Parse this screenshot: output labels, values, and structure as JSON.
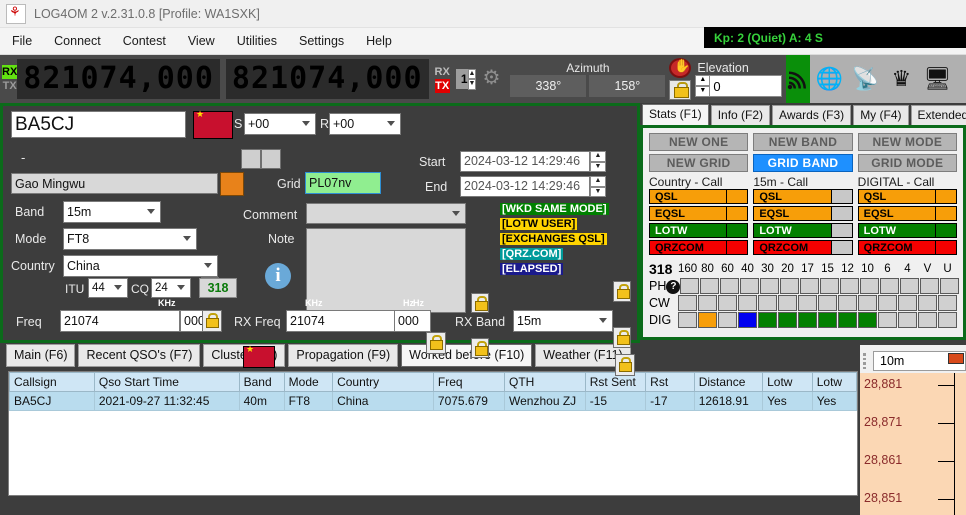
{
  "window": {
    "title": "LOG4OM 2 v.2.31.0.8 [Profile: WA1SXK]",
    "logo_icon": "log4om-logo-icon"
  },
  "menu": {
    "items": [
      "File",
      "Connect",
      "Contest",
      "View",
      "Utilities",
      "Settings",
      "Help"
    ]
  },
  "space_weather": {
    "text": "Kp: 2 (Quiet)  A: 4  S"
  },
  "rig_toolbar": {
    "rx_label": "RX",
    "tx_label": "TX",
    "vfo_a": {
      "leading": "8",
      "active": "21074",
      "trailing": "000",
      "separator": ","
    },
    "vfo_b": {
      "leading": "8",
      "active": "21074",
      "trailing": "000",
      "separator": ","
    },
    "rx_label_right": "RX",
    "tx_label_right": "TX",
    "radio_number": "1",
    "gear_icon": "gear-icon",
    "azimuth_label": "Azimuth",
    "azimuth_value": "338°",
    "azimuth_long_value": "158°",
    "stop_icon": "stop-hand-icon",
    "rotor_lock_icon": "lock-icon",
    "elevation_label": "Elevation",
    "elevation_value": "0",
    "signal_icon": "signal-waves-icon",
    "icons": [
      "globe-icon",
      "satellite-dish-icon",
      "crown-icon",
      "server-icon",
      "calculator-icon"
    ]
  },
  "qso_entry": {
    "callsign": "BA5CJ",
    "country_flag_icon": "china-flag-icon",
    "rst_sent_label": "S",
    "rst_sent": "+00",
    "rst_rcvd_label": "R",
    "rst_rcvd": "+00",
    "dash": "-",
    "name": "Gao Mingwu",
    "qrz_icon": "qrz-lookup-icon",
    "grid_label": "Grid",
    "grid": "PL07nv",
    "band_label": "Band",
    "band": "15m",
    "mode_label": "Mode",
    "mode": "FT8",
    "country_label": "Country",
    "country": "China",
    "itu_label": "ITU",
    "itu": "44",
    "cq_label": "CQ",
    "cq": "24",
    "dxcc": "318",
    "info_icon": "info-icon",
    "comment_label": "Comment",
    "comment": "",
    "note_label": "Note",
    "note": "",
    "start_label": "Start",
    "start": "2024-03-12 14:29:46",
    "end_label": "End",
    "end": "2024-03-12 14:29:46",
    "lock_icon": "lock-icon",
    "tags": [
      {
        "text": "[WKD SAME MODE]",
        "bg": "#008000",
        "fg": "#ffffff"
      },
      {
        "text": "[LOTW USER]",
        "bg": "#ffd400",
        "fg": "#000000"
      },
      {
        "text": "[EXCHANGES QSL]",
        "bg": "#ffd400",
        "fg": "#000000"
      },
      {
        "text": "[QRZ.COM]",
        "bg": "#009a9a",
        "fg": "#ffffff"
      },
      {
        "text": "[ELAPSED]",
        "bg": "#1a1a8c",
        "fg": "#ffffff"
      }
    ]
  },
  "freq_row": {
    "freq_label": "Freq",
    "khz_label": "KHz",
    "hz_label": "Hz",
    "freq_khz": "21074",
    "freq_hz": "000",
    "rx_freq_label": "RX Freq",
    "rx_khz_label": "KHz",
    "rx_hz_label": "Hz",
    "rx_freq_khz": "21074",
    "rx_freq_hz": "000",
    "rx_band_label": "RX Band",
    "rx_band": "15m",
    "lock_icon": "lock-icon"
  },
  "stats_panel": {
    "tabs": [
      {
        "label": "Stats (F1)",
        "active": true
      },
      {
        "label": "Info (F2)",
        "active": false
      },
      {
        "label": "Awards (F3)",
        "active": false
      },
      {
        "label": "My (F4)",
        "active": false
      },
      {
        "label": "Extended",
        "active": false
      }
    ],
    "status_buttons": [
      {
        "label": "NEW ONE",
        "state": "off"
      },
      {
        "label": "NEW BAND",
        "state": "off"
      },
      {
        "label": "NEW MODE",
        "state": "off"
      },
      {
        "label": "NEW GRID",
        "state": "off"
      },
      {
        "label": "GRID BAND",
        "state": "on"
      },
      {
        "label": "GRID MODE",
        "state": "off"
      }
    ],
    "columns": [
      {
        "header": "Country - Call",
        "rows": [
          {
            "label": "QSL",
            "color": "or",
            "square": "or"
          },
          {
            "label": "EQSL",
            "color": "or",
            "square": "or"
          },
          {
            "label": "LOTW",
            "color": "gr",
            "square": "gr"
          },
          {
            "label": "QRZCOM",
            "color": "rd",
            "square": "rd"
          }
        ]
      },
      {
        "header": "15m - Call",
        "rows": [
          {
            "label": "QSL",
            "color": "or",
            "square": "gy"
          },
          {
            "label": "EQSL",
            "color": "or",
            "square": "gy"
          },
          {
            "label": "LOTW",
            "color": "gr",
            "square": "gy"
          },
          {
            "label": "QRZCOM",
            "color": "rd",
            "square": "gy"
          }
        ]
      },
      {
        "header": "DIGITAL - Call",
        "rows": [
          {
            "label": "QSL",
            "color": "or",
            "square": "or"
          },
          {
            "label": "EQSL",
            "color": "or",
            "square": "or"
          },
          {
            "label": "LOTW",
            "color": "gr",
            "square": "gr"
          },
          {
            "label": "QRZCOM",
            "color": "rd",
            "square": "rd"
          }
        ]
      }
    ],
    "dxcc_count": "318",
    "band_headers": [
      "160",
      "80",
      "60",
      "40",
      "30",
      "20",
      "17",
      "15",
      "12",
      "10",
      "6",
      "4",
      "V",
      "U"
    ],
    "help_icon": "help-icon",
    "mode_rows": [
      {
        "label": "PH",
        "cells": [
          "gy",
          "gy",
          "gy",
          "gy",
          "gy",
          "gy",
          "gy",
          "gy",
          "gy",
          "gy",
          "gy",
          "gy",
          "gy",
          "gy"
        ]
      },
      {
        "label": "CW",
        "cells": [
          "gy",
          "gy",
          "gy",
          "gy",
          "gy",
          "gy",
          "gy",
          "gy",
          "gy",
          "gy",
          "gy",
          "gy",
          "gy",
          "gy"
        ]
      },
      {
        "label": "DIG",
        "cells": [
          "gy",
          "o",
          "gy",
          "b",
          "g",
          "g",
          "g",
          "g",
          "g",
          "g",
          "gy",
          "gy",
          "gy",
          "gy"
        ]
      }
    ]
  },
  "bottom_tabs": [
    {
      "label": "Main (F6)",
      "active": false
    },
    {
      "label": "Recent QSO's (F7)",
      "active": false
    },
    {
      "label": "Cluster (F8)",
      "active": false
    },
    {
      "label": "Propagation (F9)",
      "active": false
    },
    {
      "label": "Worked before (F10)",
      "active": true
    },
    {
      "label": "Weather (F11)",
      "active": false
    }
  ],
  "worked_before_table": {
    "columns": [
      "Callsign",
      "Qso Start Time",
      "Band",
      "Mode",
      "Country",
      "Freq",
      "QTH",
      "Rst Sent",
      "Rst",
      "Distance",
      "Lotw",
      "Lotw"
    ],
    "rows": [
      [
        "BA5CJ",
        "2021-09-27 11:32:45",
        "40m",
        "FT8",
        "China",
        "7075.679",
        "Wenzhou ZJ",
        "-15",
        "-17",
        "12618.91",
        "Yes",
        "Yes"
      ]
    ]
  },
  "waterfall": {
    "band": "10m",
    "grip_icon": "drag-grip-icon",
    "chevron_icon": "chevron-down-icon",
    "swatch_color": "#d84a1b",
    "ticks": [
      "28,881",
      "28,871",
      "28,861",
      "28,851"
    ]
  },
  "colors": {
    "accent_green": "#0b6b1a",
    "lcd_amber": "#f5a000",
    "highlight_blue": "#1e90ff",
    "tag_green": "#008000"
  }
}
